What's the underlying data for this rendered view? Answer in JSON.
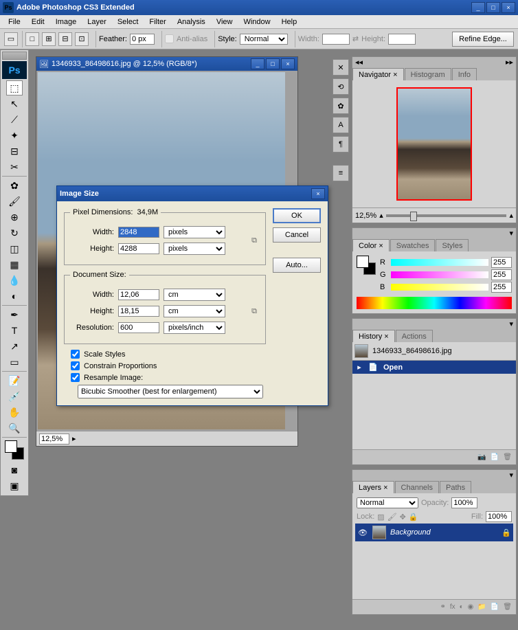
{
  "app": {
    "title": "Adobe Photoshop CS3 Extended"
  },
  "menu": [
    "File",
    "Edit",
    "Image",
    "Layer",
    "Select",
    "Filter",
    "Analysis",
    "View",
    "Window",
    "Help"
  ],
  "opt": {
    "feather": "Feather:",
    "featherval": "0 px",
    "aa": "Anti-alias",
    "style": "Style:",
    "styleval": "Normal",
    "width": "Width:",
    "height": "Height:",
    "refine": "Refine Edge..."
  },
  "doc": {
    "title": "1346933_86498616.jpg @ 12,5% (RGB/8*)",
    "zoom": "12,5%"
  },
  "dialog": {
    "title": "Image Size",
    "pxdim": "Pixel Dimensions:",
    "pxsize": "34,9M",
    "width": "Width:",
    "widthval": "2848",
    "widthunit": "pixels",
    "height": "Height:",
    "heightval": "4288",
    "heightunit": "pixels",
    "docsize": "Document Size:",
    "dwidthval": "12,06",
    "dwidthunit": "cm",
    "dheightval": "18,15",
    "dheightunit": "cm",
    "res": "Resolution:",
    "resval": "600",
    "resunit": "pixels/inch",
    "scale": "Scale Styles",
    "constrain": "Constrain Proportions",
    "resample": "Resample Image:",
    "method": "Bicubic Smoother (best for enlargement)",
    "ok": "OK",
    "cancel": "Cancel",
    "auto": "Auto..."
  },
  "nav": {
    "tab1": "Navigator",
    "tab2": "Histogram",
    "tab3": "Info",
    "zoom": "12,5%"
  },
  "color": {
    "tab1": "Color",
    "tab2": "Swatches",
    "tab3": "Styles",
    "r": "R",
    "g": "G",
    "b": "B",
    "val": "255"
  },
  "hist": {
    "tab1": "History",
    "tab2": "Actions",
    "file": "1346933_86498616.jpg",
    "open": "Open"
  },
  "layers": {
    "tab1": "Layers",
    "tab2": "Channels",
    "tab3": "Paths",
    "blend": "Normal",
    "opacity": "Opacity:",
    "opval": "100%",
    "lock": "Lock:",
    "fill": "Fill:",
    "fillval": "100%",
    "bg": "Background"
  }
}
